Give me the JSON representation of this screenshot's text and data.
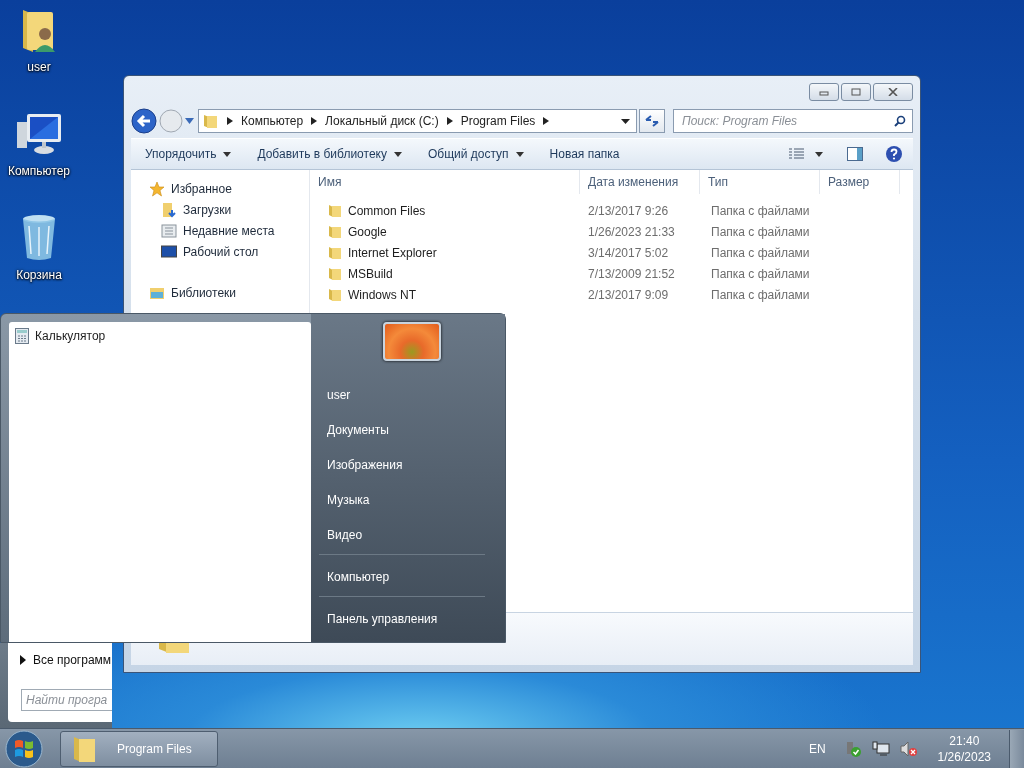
{
  "desktop_icons": [
    {
      "label": "user",
      "kind": "user-folder"
    },
    {
      "label": "Компьютер",
      "kind": "computer"
    },
    {
      "label": "Корзина",
      "kind": "recycle-bin"
    }
  ],
  "explorer": {
    "address": [
      "Компьютер",
      "Локальный диск (C:)",
      "Program Files"
    ],
    "search": {
      "placeholder": "Поиск: Program Files"
    },
    "toolbar": [
      {
        "label": "Упорядочить",
        "dropdown": true
      },
      {
        "label": "Добавить в библиотеку",
        "dropdown": true
      },
      {
        "label": "Общий доступ",
        "dropdown": true
      },
      {
        "label": "Новая папка",
        "dropdown": false
      }
    ],
    "nav": [
      {
        "label": "Избранное",
        "kind": "star",
        "children": [
          {
            "label": "Загрузки",
            "kind": "downloads"
          },
          {
            "label": "Недавние места",
            "kind": "recent"
          },
          {
            "label": "Рабочий стол",
            "kind": "desktop"
          }
        ]
      },
      {
        "label": "Библиотеки",
        "kind": "libraries"
      }
    ],
    "columns": [
      "Имя",
      "Дата изменения",
      "Тип",
      "Размер"
    ],
    "rows": [
      {
        "name": "Common Files",
        "modified": "2/13/2017 9:26",
        "type": "Папка с файлами"
      },
      {
        "name": "Google",
        "modified": "1/26/2023 21:33",
        "type": "Папка с файлами"
      },
      {
        "name": "Internet Explorer",
        "modified": "3/14/2017 5:02",
        "type": "Папка с файлами"
      },
      {
        "name": "MSBuild",
        "modified": "7/13/2009 21:52",
        "type": "Папка с файлами"
      },
      {
        "name": "Windows NT",
        "modified": "2/13/2017 9:09",
        "type": "Папка с файлами"
      }
    ]
  },
  "start_menu": {
    "programs": [
      {
        "label": "Калькулятор"
      }
    ],
    "all_programs": "Все программ",
    "search": {
      "placeholder": "Найти програ"
    },
    "link_groups": [
      [
        "user",
        "Документы",
        "Изображения",
        "Музыка",
        "Видео"
      ],
      [
        "Компьютер"
      ],
      [
        "Панель управления"
      ]
    ]
  },
  "taskbar": {
    "buttons": [
      {
        "label": "Program Files"
      }
    ],
    "language": "EN",
    "time": "21:40",
    "date": "1/26/2023"
  }
}
